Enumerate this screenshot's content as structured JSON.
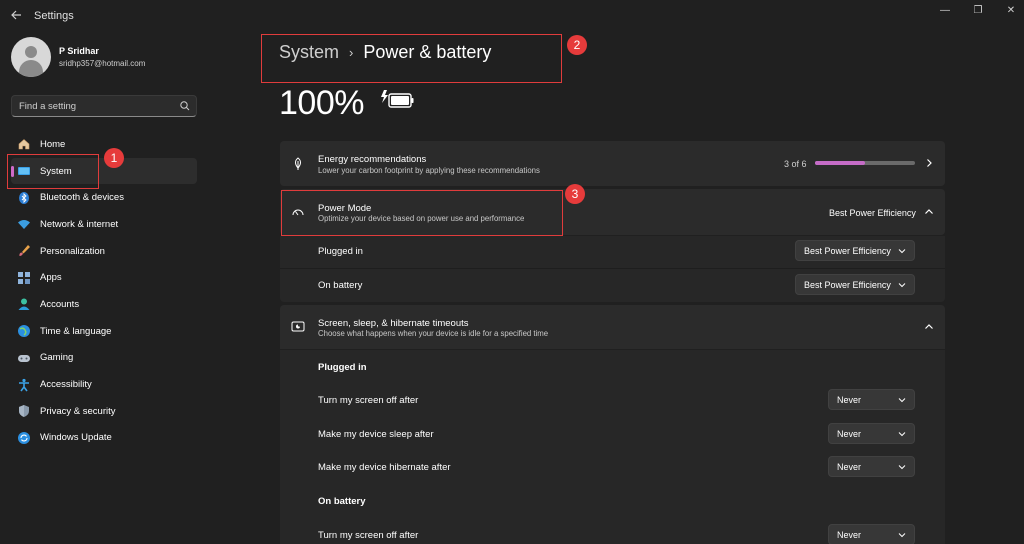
{
  "window": {
    "title": "Settings",
    "controls": {
      "minimize": "—",
      "maximize": "❐",
      "close": "✕"
    }
  },
  "profile": {
    "name": "P Sridhar",
    "email": "sridhp357@hotmail.com"
  },
  "search": {
    "placeholder": "Find a setting"
  },
  "sidebar": {
    "items": [
      {
        "label": "Home",
        "icon": "home-icon"
      },
      {
        "label": "System",
        "icon": "system-icon",
        "active": true
      },
      {
        "label": "Bluetooth & devices",
        "icon": "bluetooth-icon"
      },
      {
        "label": "Network & internet",
        "icon": "wifi-icon"
      },
      {
        "label": "Personalization",
        "icon": "brush-icon"
      },
      {
        "label": "Apps",
        "icon": "apps-icon"
      },
      {
        "label": "Accounts",
        "icon": "accounts-icon"
      },
      {
        "label": "Time & language",
        "icon": "globe-icon"
      },
      {
        "label": "Gaming",
        "icon": "gamepad-icon"
      },
      {
        "label": "Accessibility",
        "icon": "accessibility-icon"
      },
      {
        "label": "Privacy & security",
        "icon": "shield-icon"
      },
      {
        "label": "Windows Update",
        "icon": "update-icon"
      }
    ]
  },
  "annotations": [
    "1",
    "2",
    "3"
  ],
  "breadcrumb": {
    "parent": "System",
    "separator": "›",
    "current": "Power & battery"
  },
  "battery": {
    "percent_text": "100%",
    "level": 1.0
  },
  "energy": {
    "title": "Energy recommendations",
    "desc": "Lower your carbon footprint by applying these recommendations",
    "progress_text": "3 of 6",
    "progress": 0.5
  },
  "power_mode": {
    "title": "Power Mode",
    "desc": "Optimize your device based on power use and performance",
    "value": "Best Power Efficiency",
    "plugged_in": {
      "label": "Plugged in",
      "value": "Best Power Efficiency"
    },
    "on_battery": {
      "label": "On battery",
      "value": "Best Power Efficiency"
    }
  },
  "timeouts": {
    "title": "Screen, sleep, & hibernate timeouts",
    "desc": "Choose what happens when your device is idle for a specified time",
    "plugged_in_label": "Plugged in",
    "plugged_rows": [
      {
        "label": "Turn my screen off after",
        "value": "Never"
      },
      {
        "label": "Make my device sleep after",
        "value": "Never"
      },
      {
        "label": "Make my device hibernate after",
        "value": "Never"
      }
    ],
    "battery_label": "On battery",
    "battery_rows": [
      {
        "label": "Turn my screen off after",
        "value": "Never"
      }
    ]
  },
  "colors": {
    "background": "#202020",
    "accent": "#c56cc7",
    "annotation": "#e03c3c"
  }
}
